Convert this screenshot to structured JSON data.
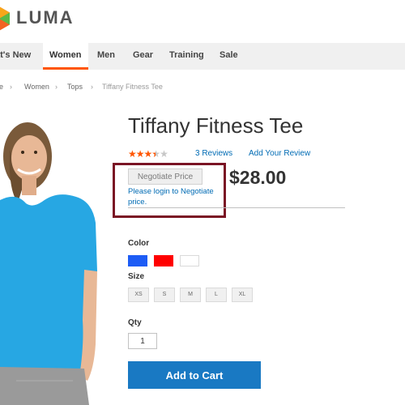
{
  "brand": {
    "name": "LUMA",
    "colors": {
      "orange": "#f26322",
      "red": "#e03a2c",
      "yellow": "#f9a61a",
      "green": "#5cb848",
      "blue": "#1979c3",
      "link": "#006bb4"
    }
  },
  "nav": {
    "items": [
      {
        "label": "at's New",
        "active": false
      },
      {
        "label": "Women",
        "active": true
      },
      {
        "label": "Men",
        "active": false
      },
      {
        "label": "Gear",
        "active": false
      },
      {
        "label": "Training",
        "active": false
      },
      {
        "label": "Sale",
        "active": false
      }
    ]
  },
  "breadcrumb": {
    "items": [
      "e",
      "Women",
      "Tops",
      "Tiffany Fitness Tee"
    ],
    "separator": "›"
  },
  "product": {
    "title": "Tiffany Fitness Tee",
    "rating_stars": 3.5,
    "rating_max": 5,
    "reviews_label": "3 Reviews",
    "add_review_label": "Add Your Review",
    "negotiate_label": "Negotiate Price",
    "login_text": "Please login to Negotiate price.",
    "price": "$28.00",
    "image_icon": "woman-blue-tee-photo"
  },
  "options": {
    "color_label": "Color",
    "colors": [
      "#1d5cf5",
      "#ff0000",
      "#ffffff"
    ],
    "size_label": "Size",
    "sizes": [
      "XS",
      "S",
      "M",
      "L",
      "XL"
    ],
    "qty_label": "Qty",
    "qty_value": "1"
  },
  "cart": {
    "button_label": "Add to Cart"
  }
}
